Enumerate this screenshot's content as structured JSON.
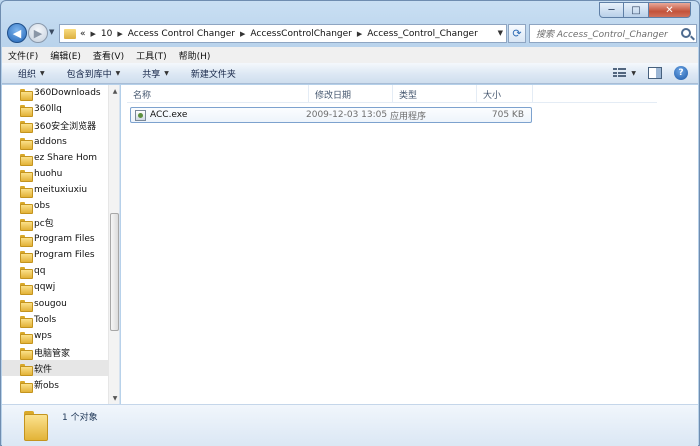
{
  "window": {
    "caption_buttons": [
      "─",
      "□",
      "✕"
    ]
  },
  "nav": {
    "back_glyph": "◀",
    "forward_glyph": "▶",
    "history_glyph": "▼",
    "refresh_glyph": "⟳"
  },
  "address": {
    "overflow": "«",
    "crumbs": [
      "10",
      "Access Control Changer",
      "AccessControlChanger",
      "Access_Control_Changer"
    ],
    "separator": "▶",
    "dropdown_glyph": "▼"
  },
  "search": {
    "placeholder": "搜索 Access_Control_Changer"
  },
  "menubar": {
    "items": [
      "文件(F)",
      "编辑(E)",
      "查看(V)",
      "工具(T)",
      "帮助(H)"
    ]
  },
  "toolbar": {
    "buttons": [
      "组织",
      "包含到库中",
      "共享",
      "新建文件夹"
    ],
    "dropdown_glyph": "▼",
    "help_glyph": "?"
  },
  "navpane": {
    "items": [
      "360Downloads",
      "360llq",
      "360安全浏览器",
      "addons",
      "ez Share Hom",
      "huohu",
      "meituxiuxiu",
      "obs",
      "pc包",
      "Program Files",
      "Program Files",
      "qq",
      "qqwj",
      "sougou",
      "Tools",
      "wps",
      "电脑管家",
      "软件",
      "新obs"
    ],
    "selected_index": 17,
    "scroll_up": "▲",
    "scroll_down": "▼"
  },
  "columns": [
    "名称",
    "修改日期",
    "类型",
    "大小"
  ],
  "files": [
    {
      "name": "ACC.exe",
      "date": "2009-12-03 13:05",
      "type": "应用程序",
      "size": "705 KB"
    }
  ],
  "details": {
    "status": "1 个对象"
  },
  "colors": {
    "accent": "#2366b8",
    "window_frame": "#b9d2ea",
    "selection_border": "#7da2ce"
  }
}
